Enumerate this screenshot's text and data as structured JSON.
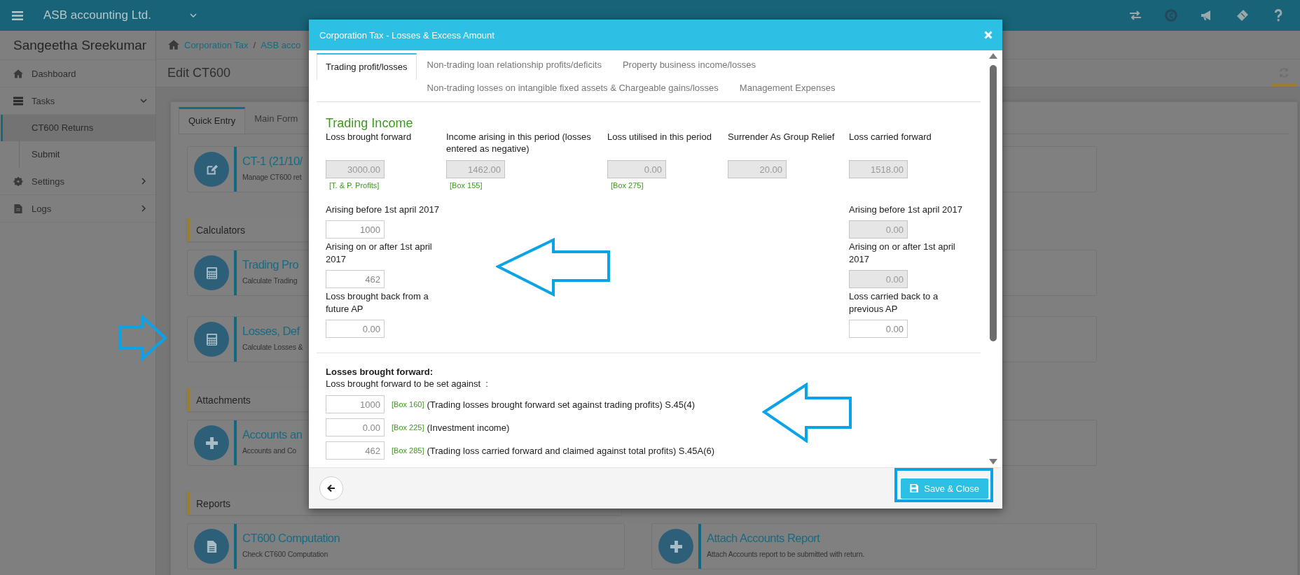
{
  "topbar": {
    "company": "ASB accounting Ltd."
  },
  "sidebar": {
    "user": "Sangeetha Sreekumar",
    "items": [
      {
        "label": "Dashboard"
      },
      {
        "label": "Tasks",
        "expanded": true,
        "children": [
          {
            "label": "CT600 Returns",
            "selected": true
          },
          {
            "label": "Submit",
            "selected": false
          }
        ]
      },
      {
        "label": "Settings",
        "expanded": false
      },
      {
        "label": "Logs",
        "expanded": false
      }
    ]
  },
  "breadcrumb": [
    "Corporation Tax",
    "ASB acco"
  ],
  "breadcrumb_separator": "/",
  "page_title": "Edit CT600",
  "tabs": [
    {
      "label": "Quick Entry",
      "selected": true
    },
    {
      "label": "Main Form",
      "selected": false
    }
  ],
  "rows": [
    {
      "kind": "cards",
      "cards": [
        {
          "kind": "card",
          "title": "CT-1 (21/10/",
          "subtitle": "Manage CT600 ret"
        },
        {
          "kind": "covered"
        }
      ]
    },
    {
      "kind": "header",
      "label": "Calculators"
    },
    {
      "kind": "cards",
      "cards": [
        {
          "kind": "card",
          "title": "Trading Pro",
          "subtitle": "Calculate Trading"
        },
        {
          "kind": "covered"
        }
      ]
    },
    {
      "kind": "cards",
      "cards": [
        {
          "kind": "card",
          "title": "Losses, Def",
          "subtitle": "Calculate Losses &"
        },
        {
          "kind": "covered"
        }
      ]
    },
    {
      "kind": "header",
      "label": "Attachments"
    },
    {
      "kind": "cards",
      "cards": [
        {
          "kind": "card",
          "title": "Accounts an",
          "subtitle": "Accounts and Co"
        },
        {
          "kind": "covered"
        }
      ]
    },
    {
      "kind": "header",
      "label": "Reports"
    },
    {
      "kind": "cards",
      "cards": [
        {
          "kind": "card",
          "title": "CT600 Computation",
          "subtitle": "Check CT600 Computation"
        },
        {
          "kind": "card",
          "title": "Attach Accounts Report",
          "subtitle": "Attach Accounts report to be submitted with return."
        }
      ]
    }
  ],
  "modal": {
    "title": "Corporation Tax - Losses & Excess Amount",
    "tabs": [
      {
        "label": "Trading profit/losses",
        "selected": true
      },
      {
        "label": "Non-trading loan relationship profits/deficits",
        "selected": false
      },
      {
        "label": "Property business income/losses",
        "selected": false
      },
      {
        "label": "Non-trading losses on intangible fixed assets & Chargeable gains/losses",
        "selected": false
      },
      {
        "label": "Management Expenses",
        "selected": false
      }
    ],
    "section_title": "Trading Income",
    "columns": [
      {
        "label": "Loss brought forward",
        "value": "3000.00",
        "readonly": true,
        "box": "[T. & P. Profits]"
      },
      {
        "label": "Income arising in this period (losses entered as negative)",
        "value": "1462.00",
        "readonly": true,
        "box": "[Box 155]"
      },
      {
        "label": "Loss utilised in this period",
        "value": "0.00",
        "readonly": true,
        "box": "[Box 275]"
      },
      {
        "label": "Surrender As Group Relief",
        "value": "20.00",
        "readonly": true
      },
      {
        "label": "Loss carried forward",
        "value": "1518.00",
        "readonly": true
      }
    ],
    "left_fields": [
      {
        "label": "Arising before 1st april 2017",
        "value": "1000",
        "readonly": false
      },
      {
        "label": "Arising on or after 1st april 2017",
        "value": "462",
        "readonly": false
      },
      {
        "label": "Loss brought back from a future AP",
        "value": "0.00",
        "readonly": false
      }
    ],
    "right_fields": [
      {
        "label": "Arising before 1st april 2017",
        "value": "0.00",
        "readonly": true
      },
      {
        "label": "Arising on or after 1st april 2017",
        "value": "0.00",
        "readonly": true
      },
      {
        "label": "Loss carried back to a previous AP",
        "value": "0.00",
        "readonly": false
      }
    ],
    "losses": {
      "title": "Losses brought forward:",
      "subtitle": "Loss brought forward to be set against  :",
      "rows": [
        {
          "value": "1000",
          "box": "[Box 160]",
          "text": "(Trading losses brought forward set against trading profits) S.45(4)"
        },
        {
          "value": "0.00",
          "box": "[Box 225]",
          "text": "(Investment income)"
        },
        {
          "value": "462",
          "box": "[Box 285]",
          "text": "(Trading loss carried forward and claimed against total profits) S.45A(6)"
        }
      ]
    },
    "save_label": "Save & Close"
  }
}
